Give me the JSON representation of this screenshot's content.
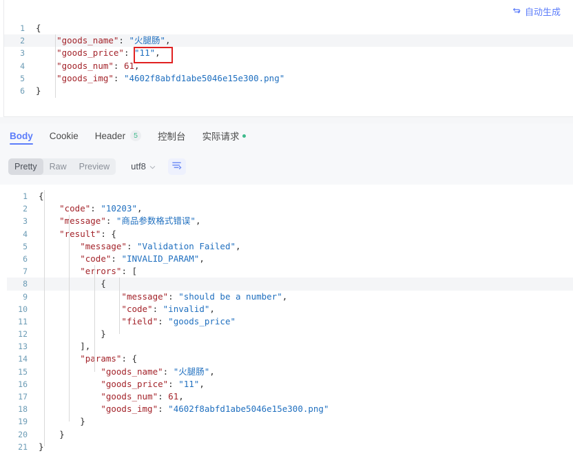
{
  "colors": {
    "accent": "#5b7cfa",
    "key": "#a3232a",
    "string": "#1f6fbf",
    "green": "#3fba8c",
    "highlight_box": "#e02020",
    "toolbar_bg": "#f7f8fa"
  },
  "request_panel": {
    "auto_generate_label": "自动生成",
    "auto_generate_icon": "sync-loop-icon",
    "lines": [
      {
        "num": "1",
        "parts": [
          {
            "t": "{",
            "c": "p"
          }
        ]
      },
      {
        "num": "2",
        "highlight": true,
        "parts": [
          {
            "t": "    ",
            "c": "p"
          },
          {
            "t": "\"goods_name\"",
            "c": "k"
          },
          {
            "t": ": ",
            "c": "p"
          },
          {
            "t": "\"火腿肠\"",
            "c": "s"
          },
          {
            "t": ",",
            "c": "p"
          }
        ]
      },
      {
        "num": "3",
        "parts": [
          {
            "t": "    ",
            "c": "p"
          },
          {
            "t": "\"goods_price\"",
            "c": "k"
          },
          {
            "t": ": ",
            "c": "p"
          },
          {
            "t": "\"11\"",
            "c": "s"
          },
          {
            "t": ",",
            "c": "p"
          }
        ]
      },
      {
        "num": "4",
        "parts": [
          {
            "t": "    ",
            "c": "p"
          },
          {
            "t": "\"goods_num\"",
            "c": "k"
          },
          {
            "t": ": ",
            "c": "p"
          },
          {
            "t": "61",
            "c": "n"
          },
          {
            "t": ",",
            "c": "p"
          }
        ]
      },
      {
        "num": "5",
        "parts": [
          {
            "t": "    ",
            "c": "p"
          },
          {
            "t": "\"goods_img\"",
            "c": "k"
          },
          {
            "t": ": ",
            "c": "p"
          },
          {
            "t": "\"4602f8abfd1abe5046e15e300.png\"",
            "c": "s"
          }
        ]
      },
      {
        "num": "6",
        "parts": [
          {
            "t": "}",
            "c": "p"
          }
        ]
      }
    ]
  },
  "tabs": [
    {
      "label": "Body",
      "active": true
    },
    {
      "label": "Cookie",
      "active": false
    },
    {
      "label": "Header",
      "active": false,
      "badge": "5"
    },
    {
      "label": "控制台",
      "active": false
    },
    {
      "label": "实际请求",
      "active": false,
      "dot": true
    }
  ],
  "subtoolbar": {
    "segments": [
      {
        "label": "Pretty",
        "active": true
      },
      {
        "label": "Raw",
        "active": false
      },
      {
        "label": "Preview",
        "active": false
      }
    ],
    "encoding": "utf8",
    "encoding_icon": "chevron-down-icon",
    "format_icon": "format-indent-icon"
  },
  "response_panel": {
    "lines": [
      {
        "num": "1",
        "parts": [
          {
            "t": "{",
            "c": "p"
          }
        ]
      },
      {
        "num": "2",
        "parts": [
          {
            "t": "    ",
            "c": "p"
          },
          {
            "t": "\"code\"",
            "c": "k"
          },
          {
            "t": ": ",
            "c": "p"
          },
          {
            "t": "\"10203\"",
            "c": "s"
          },
          {
            "t": ",",
            "c": "p"
          }
        ]
      },
      {
        "num": "3",
        "parts": [
          {
            "t": "    ",
            "c": "p"
          },
          {
            "t": "\"message\"",
            "c": "k"
          },
          {
            "t": ": ",
            "c": "p"
          },
          {
            "t": "\"商品参数格式错误\"",
            "c": "s"
          },
          {
            "t": ",",
            "c": "p"
          }
        ]
      },
      {
        "num": "4",
        "parts": [
          {
            "t": "    ",
            "c": "p"
          },
          {
            "t": "\"result\"",
            "c": "k"
          },
          {
            "t": ": {",
            "c": "p"
          }
        ]
      },
      {
        "num": "5",
        "parts": [
          {
            "t": "        ",
            "c": "p"
          },
          {
            "t": "\"message\"",
            "c": "k"
          },
          {
            "t": ": ",
            "c": "p"
          },
          {
            "t": "\"Validation Failed\"",
            "c": "s"
          },
          {
            "t": ",",
            "c": "p"
          }
        ]
      },
      {
        "num": "6",
        "parts": [
          {
            "t": "        ",
            "c": "p"
          },
          {
            "t": "\"code\"",
            "c": "k"
          },
          {
            "t": ": ",
            "c": "p"
          },
          {
            "t": "\"INVALID_PARAM\"",
            "c": "s"
          },
          {
            "t": ",",
            "c": "p"
          }
        ]
      },
      {
        "num": "7",
        "parts": [
          {
            "t": "        ",
            "c": "p"
          },
          {
            "t": "\"errors\"",
            "c": "k"
          },
          {
            "t": ": [",
            "c": "p"
          }
        ]
      },
      {
        "num": "8",
        "highlight": true,
        "parts": [
          {
            "t": "            {",
            "c": "p"
          }
        ]
      },
      {
        "num": "9",
        "parts": [
          {
            "t": "                ",
            "c": "p"
          },
          {
            "t": "\"message\"",
            "c": "k"
          },
          {
            "t": ": ",
            "c": "p"
          },
          {
            "t": "\"should be a number\"",
            "c": "s"
          },
          {
            "t": ",",
            "c": "p"
          }
        ]
      },
      {
        "num": "10",
        "parts": [
          {
            "t": "                ",
            "c": "p"
          },
          {
            "t": "\"code\"",
            "c": "k"
          },
          {
            "t": ": ",
            "c": "p"
          },
          {
            "t": "\"invalid\"",
            "c": "s"
          },
          {
            "t": ",",
            "c": "p"
          }
        ]
      },
      {
        "num": "11",
        "parts": [
          {
            "t": "                ",
            "c": "p"
          },
          {
            "t": "\"field\"",
            "c": "k"
          },
          {
            "t": ": ",
            "c": "p"
          },
          {
            "t": "\"goods_price\"",
            "c": "s"
          }
        ]
      },
      {
        "num": "12",
        "parts": [
          {
            "t": "            }",
            "c": "p"
          }
        ]
      },
      {
        "num": "13",
        "parts": [
          {
            "t": "        ],",
            "c": "p"
          }
        ]
      },
      {
        "num": "14",
        "parts": [
          {
            "t": "        ",
            "c": "p"
          },
          {
            "t": "\"params\"",
            "c": "k"
          },
          {
            "t": ": {",
            "c": "p"
          }
        ]
      },
      {
        "num": "15",
        "parts": [
          {
            "t": "            ",
            "c": "p"
          },
          {
            "t": "\"goods_name\"",
            "c": "k"
          },
          {
            "t": ": ",
            "c": "p"
          },
          {
            "t": "\"火腿肠\"",
            "c": "s"
          },
          {
            "t": ",",
            "c": "p"
          }
        ]
      },
      {
        "num": "16",
        "parts": [
          {
            "t": "            ",
            "c": "p"
          },
          {
            "t": "\"goods_price\"",
            "c": "k"
          },
          {
            "t": ": ",
            "c": "p"
          },
          {
            "t": "\"11\"",
            "c": "s"
          },
          {
            "t": ",",
            "c": "p"
          }
        ]
      },
      {
        "num": "17",
        "parts": [
          {
            "t": "            ",
            "c": "p"
          },
          {
            "t": "\"goods_num\"",
            "c": "k"
          },
          {
            "t": ": ",
            "c": "p"
          },
          {
            "t": "61",
            "c": "n"
          },
          {
            "t": ",",
            "c": "p"
          }
        ]
      },
      {
        "num": "18",
        "parts": [
          {
            "t": "            ",
            "c": "p"
          },
          {
            "t": "\"goods_img\"",
            "c": "k"
          },
          {
            "t": ": ",
            "c": "p"
          },
          {
            "t": "\"4602f8abfd1abe5046e15e300.png\"",
            "c": "s"
          }
        ]
      },
      {
        "num": "19",
        "parts": [
          {
            "t": "        }",
            "c": "p"
          }
        ]
      },
      {
        "num": "20",
        "parts": [
          {
            "t": "    }",
            "c": "p"
          }
        ]
      },
      {
        "num": "21",
        "parts": [
          {
            "t": "}",
            "c": "p"
          }
        ]
      }
    ]
  }
}
